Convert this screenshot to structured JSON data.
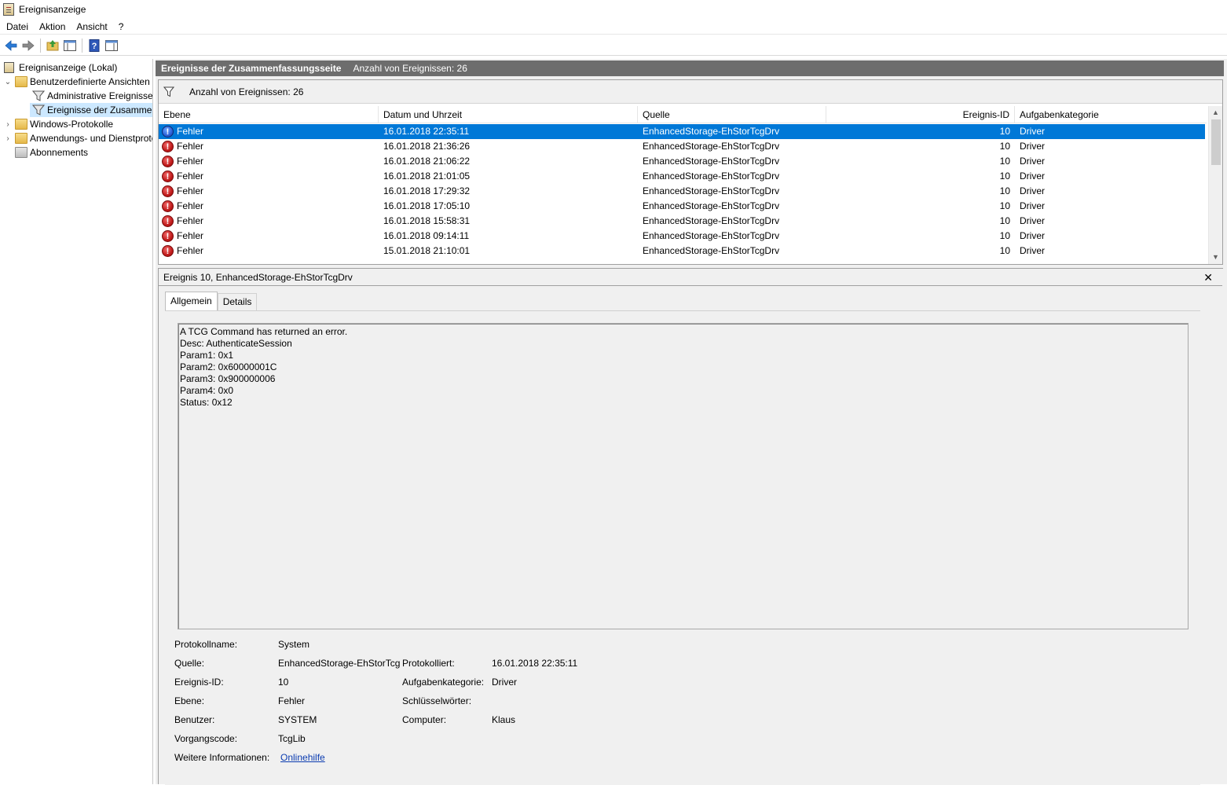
{
  "window": {
    "title": "Ereignisanzeige"
  },
  "menu": [
    "Datei",
    "Aktion",
    "Ansicht",
    "?"
  ],
  "toolbar": [
    "back-icon",
    "forward-icon",
    "folder-up-icon",
    "show-hide-tree-icon",
    "help-icon",
    "show-hide-action-pane-icon"
  ],
  "tree": {
    "root": "Ereignisanzeige (Lokal)",
    "custom_views": "Benutzerdefinierte Ansichten",
    "admin_events": "Administrative Ereignisse",
    "summary_events": "Ereignisse der Zusammenfassungsseite",
    "windows_logs": "Windows-Protokolle",
    "app_logs": "Anwendungs- und Dienstprotokolle",
    "subscriptions": "Abonnements"
  },
  "header": {
    "title": "Ereignisse der Zusammenfassungsseite",
    "count": "Anzahl von Ereignissen: 26"
  },
  "filter": {
    "text": "Anzahl von Ereignissen: 26"
  },
  "grid": {
    "columns": [
      "Ebene",
      "Datum und Uhrzeit",
      "Quelle",
      "Ereignis-ID",
      "Aufgabenkategorie"
    ],
    "rows": [
      [
        "Fehler",
        "16.01.2018 22:35:11",
        "EnhancedStorage-EhStorTcgDrv",
        "10",
        "Driver"
      ],
      [
        "Fehler",
        "16.01.2018 21:36:26",
        "EnhancedStorage-EhStorTcgDrv",
        "10",
        "Driver"
      ],
      [
        "Fehler",
        "16.01.2018 21:06:22",
        "EnhancedStorage-EhStorTcgDrv",
        "10",
        "Driver"
      ],
      [
        "Fehler",
        "16.01.2018 21:01:05",
        "EnhancedStorage-EhStorTcgDrv",
        "10",
        "Driver"
      ],
      [
        "Fehler",
        "16.01.2018 17:29:32",
        "EnhancedStorage-EhStorTcgDrv",
        "10",
        "Driver"
      ],
      [
        "Fehler",
        "16.01.2018 17:05:10",
        "EnhancedStorage-EhStorTcgDrv",
        "10",
        "Driver"
      ],
      [
        "Fehler",
        "16.01.2018 15:58:31",
        "EnhancedStorage-EhStorTcgDrv",
        "10",
        "Driver"
      ],
      [
        "Fehler",
        "16.01.2018 09:14:11",
        "EnhancedStorage-EhStorTcgDrv",
        "10",
        "Driver"
      ],
      [
        "Fehler",
        "15.01.2018 21:10:01",
        "EnhancedStorage-EhStorTcgDrv",
        "10",
        "Driver"
      ]
    ]
  },
  "detail": {
    "title": "Ereignis 10, EnhancedStorage-EhStorTcgDrv",
    "tabs": [
      "Allgemein",
      "Details"
    ],
    "message": [
      "A TCG Command has returned an error.",
      "Desc: AuthenticateSession",
      "Param1: 0x1",
      "Param2: 0x60000001C",
      "Param3: 0x900000006",
      "Param4: 0x0",
      "Status: 0x12"
    ],
    "props": {
      "log_name_label": "Protokollname:",
      "log_name": "System",
      "source_label": "Quelle:",
      "source": "EnhancedStorage-EhStorTcg",
      "logged_label": "Protokolliert:",
      "logged": "16.01.2018 22:35:11",
      "event_id_label": "Ereignis-ID:",
      "event_id": "10",
      "task_cat_label": "Aufgabenkategorie:",
      "task_cat": "Driver",
      "level_label": "Ebene:",
      "level": "Fehler",
      "keywords_label": "Schlüsselwörter:",
      "keywords": "",
      "user_label": "Benutzer:",
      "user": "SYSTEM",
      "computer_label": "Computer:",
      "computer": "Klaus",
      "opcode_label": "Vorgangscode:",
      "opcode": "TcgLib",
      "more_info_label": "Weitere Informationen:",
      "more_info_link": "Onlinehilfe"
    }
  },
  "colors": {
    "selection": "#0078d7",
    "header": "#6d6d6d",
    "error": "#c11b1b",
    "link": "#0a3bb0"
  }
}
